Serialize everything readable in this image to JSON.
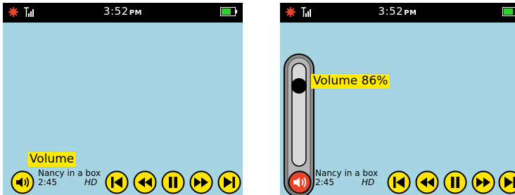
{
  "screens": [
    {
      "status": {
        "time": "3:52",
        "ampm": "PM"
      },
      "now_playing": {
        "title": "Nancy in a box",
        "time": "2:45",
        "quality": "HD"
      },
      "callout": "Volume"
    },
    {
      "status": {
        "time": "3:52",
        "ampm": "PM"
      },
      "now_playing": {
        "title": "Nancy in a box",
        "time": "2:45",
        "quality": "HD"
      },
      "callout": "Volume 86%",
      "volume_level": 0.86
    }
  ],
  "icons": [
    "settings-gear-icon",
    "signal-icon",
    "battery-icon",
    "volume-icon",
    "previous-track-icon",
    "rewind-icon",
    "pause-icon",
    "fast-forward-icon",
    "next-track-icon"
  ],
  "colors": {
    "screen_bg": "#a6d4e2",
    "control_yellow": "#ffe600",
    "volume_active": "#e8442a",
    "callout": "#ffeb00",
    "battery_green": "#33cc33"
  }
}
